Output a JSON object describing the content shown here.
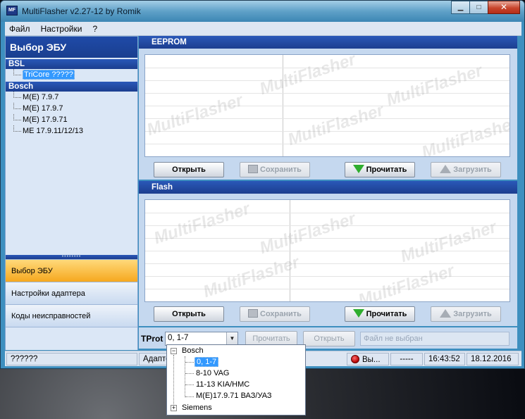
{
  "window": {
    "title": "MultiFlasher v2.27-12 by Romik",
    "icon_text": "MF",
    "controls": {
      "minimize": "▁",
      "maximize": "□",
      "close": "✕"
    }
  },
  "menu": [
    "Файл",
    "Настройки",
    "?"
  ],
  "left_panel": {
    "header": "Выбор ЭБУ",
    "groups": [
      {
        "name": "BSL",
        "items": [
          {
            "label": "TriCore ?????",
            "selected": true
          }
        ]
      },
      {
        "name": "Bosch",
        "items": [
          {
            "label": "M(E) 7.9.7",
            "selected": false
          },
          {
            "label": "M(E) 17.9.7",
            "selected": false
          },
          {
            "label": "M(E) 17.9.71",
            "selected": false
          },
          {
            "label": "ME 17.9.11/12/13",
            "selected": false
          }
        ]
      }
    ],
    "nav": [
      {
        "label": "Выбор ЭБУ",
        "active": true
      },
      {
        "label": "Настройки адаптера",
        "active": false
      },
      {
        "label": "Коды неисправностей",
        "active": false
      }
    ]
  },
  "eeprom": {
    "header": "EEPROM",
    "buttons": {
      "open": "Открыть",
      "save": "Сохранить",
      "read": "Прочитать",
      "load": "Загрузить"
    }
  },
  "flash": {
    "header": "Flash",
    "buttons": {
      "open": "Открыть",
      "save": "Сохранить",
      "read": "Прочитать",
      "load": "Загрузить"
    }
  },
  "watermark": "MultiFlasher",
  "controls_row": {
    "tprot_label": "TProt",
    "combo_value": "0, 1-7",
    "read_button": "Прочитать",
    "open_button": "Открыть",
    "file_status": "Файл не выбран"
  },
  "dropdown": {
    "groups": [
      {
        "name": "Bosch",
        "expanded": true,
        "expander": "−",
        "items": [
          {
            "label": "0, 1-7",
            "selected": true
          },
          {
            "label": "8-10 VAG",
            "selected": false
          },
          {
            "label": "11-13 KIA/HMC",
            "selected": false
          },
          {
            "label": "M(E)17.9.71 ВАЗ/УАЗ",
            "selected": false
          }
        ]
      },
      {
        "name": "Siemens",
        "expanded": false,
        "expander": "+",
        "items": []
      }
    ]
  },
  "statusbar": {
    "left": "??????",
    "adapter": "Адапте",
    "indicator": "Вы...",
    "dashes": "-----",
    "time": "16:43:52",
    "date": "18.12.2016"
  },
  "colors": {
    "accent_blue": "#1c3e8f",
    "active_nav": "#f6a81f",
    "selection": "#3399ff",
    "read_arrow": "#2fae2f"
  }
}
